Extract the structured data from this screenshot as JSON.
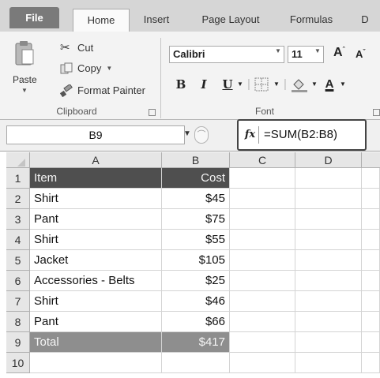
{
  "tabs": {
    "file": "File",
    "home": "Home",
    "insert": "Insert",
    "page_layout": "Page Layout",
    "formulas": "Formulas",
    "overflow": "D"
  },
  "clipboard": {
    "paste": "Paste",
    "cut": "Cut",
    "copy": "Copy",
    "format_painter": "Format Painter",
    "group_label": "Clipboard"
  },
  "font": {
    "name": "Calibri",
    "size": "11",
    "bold": "B",
    "italic": "I",
    "underline": "U",
    "group_label": "Font"
  },
  "formula_bar": {
    "name_box": "B9",
    "fx": "fx",
    "formula": "=SUM(B2:B8)"
  },
  "grid": {
    "columns": [
      "A",
      "B",
      "C",
      "D"
    ],
    "rows": [
      {
        "num": "1",
        "item": "Item",
        "cost": "Cost"
      },
      {
        "num": "2",
        "item": "Shirt",
        "cost": "$45"
      },
      {
        "num": "3",
        "item": "Pant",
        "cost": "$75"
      },
      {
        "num": "4",
        "item": "Shirt",
        "cost": "$55"
      },
      {
        "num": "5",
        "item": "Jacket",
        "cost": "$105"
      },
      {
        "num": "6",
        "item": "Accessories - Belts",
        "cost": "$25"
      },
      {
        "num": "7",
        "item": "Shirt",
        "cost": "$46"
      },
      {
        "num": "8",
        "item": "Pant",
        "cost": "$66"
      },
      {
        "num": "9",
        "item": "Total",
        "cost": "$417"
      },
      {
        "num": "10",
        "item": "",
        "cost": ""
      }
    ]
  },
  "colors": {
    "header_fill": "#4f4f4f",
    "total_fill": "#8e8e8e"
  }
}
